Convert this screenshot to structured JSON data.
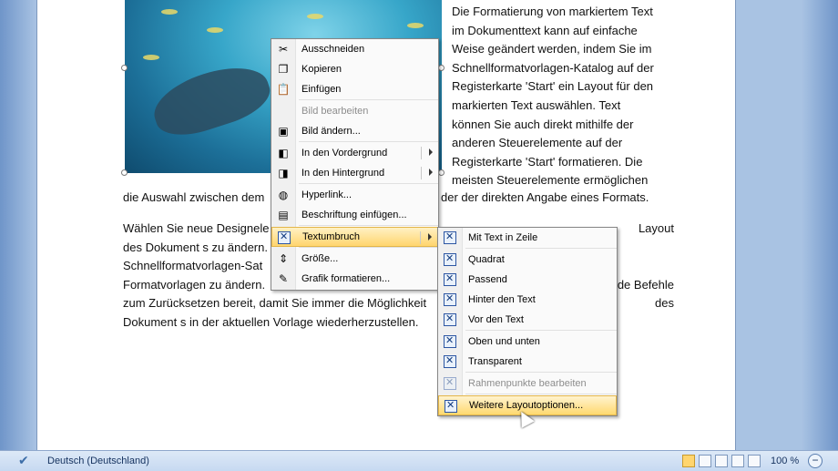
{
  "document": {
    "right_column": [
      "Die Formatierung von markiertem Text",
      "im Dokumenttext kann auf einfache",
      "Weise geändert werden, indem Sie im",
      "Schnellformatvorlagen-Katalog auf der",
      "Registerkarte 'Start' ein Layout für den",
      "markierten Text auswählen. Text",
      "können Sie auch direkt mithilfe der",
      "anderen Steuerelemente auf der",
      "Registerkarte 'Start' formatieren. Die",
      "meisten Steuerelemente ermöglichen"
    ],
    "line_full_left": "die Auswahl zwischen dem",
    "line_full_right": "der der direkten Angabe eines Formats.",
    "para2_left": [
      "Wählen Sie neue Designele",
      "des Dokument s zu ändern.",
      "Schnellformatvorlagen-Sat",
      "Formatvorlagen zu ändern.",
      "zum Zurücksetzen bereit, damit Sie immer die Möglichkeit",
      "Dokument s in der aktuellen Vorlage wiederherzustellen."
    ],
    "para2_right": [
      "Layout",
      "",
      "",
      "de Befehle",
      "des",
      ""
    ]
  },
  "context_menu": {
    "items": [
      {
        "label": "Ausschneiden",
        "icon": "scissors-icon"
      },
      {
        "label": "Kopieren",
        "icon": "copy-icon"
      },
      {
        "label": "Einfügen",
        "icon": "paste-icon"
      },
      {
        "label": "Bild bearbeiten",
        "icon": "",
        "disabled": true
      },
      {
        "label": "Bild ändern...",
        "icon": "picture-icon"
      },
      {
        "label": "In den Vordergrund",
        "icon": "bring-front-icon",
        "submenu": true
      },
      {
        "label": "In den Hintergrund",
        "icon": "send-back-icon",
        "submenu": true
      },
      {
        "label": "Hyperlink...",
        "icon": "hyperlink-icon"
      },
      {
        "label": "Beschriftung einfügen...",
        "icon": "caption-icon"
      },
      {
        "label": "Textumbruch",
        "icon": "text-wrap-icon",
        "submenu": true,
        "highlighted": true
      },
      {
        "label": "Größe...",
        "icon": "size-icon"
      },
      {
        "label": "Grafik formatieren...",
        "icon": "format-picture-icon"
      }
    ]
  },
  "submenu": {
    "items": [
      {
        "label": "Mit Text in Zeile"
      },
      {
        "label": "Quadrat"
      },
      {
        "label": "Passend"
      },
      {
        "label": "Hinter den Text"
      },
      {
        "label": "Vor den Text"
      },
      {
        "label": "Oben und unten"
      },
      {
        "label": "Transparent"
      },
      {
        "label": "Rahmenpunkte bearbeiten",
        "disabled": true
      },
      {
        "label": "Weitere Layoutoptionen...",
        "highlighted": true
      }
    ]
  },
  "status_bar": {
    "language": "Deutsch (Deutschland)",
    "zoom": "100 %",
    "zoom_out": "−"
  },
  "colors": {
    "highlight": "#ffd56e",
    "workspace": "#a9c3e3",
    "statusbar": "#c6d9f1"
  }
}
